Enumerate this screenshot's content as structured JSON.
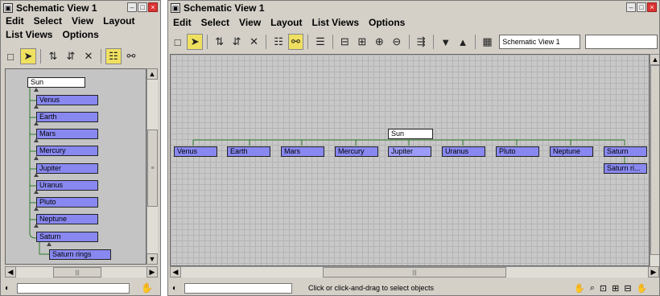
{
  "left_window": {
    "title": "Schematic View 1",
    "menu": [
      "Edit",
      "Select",
      "View",
      "Layout",
      "List Views",
      "Options"
    ],
    "nodes": [
      "Sun",
      "Venus",
      "Earth",
      "Mars",
      "Mercury",
      "Jupiter",
      "Uranus",
      "Pluto",
      "Neptune",
      "Saturn",
      "Saturn rings"
    ]
  },
  "right_window": {
    "title": "Schematic View 1",
    "menu": [
      "Edit",
      "Select",
      "View",
      "Layout",
      "List Views",
      "Options"
    ],
    "view_name_field": "Schematic View 1",
    "nodes": [
      "Sun",
      "Venus",
      "Earth",
      "Mars",
      "Mercury",
      "Jupiter",
      "Uranus",
      "Pluto",
      "Neptune",
      "Saturn",
      "Saturn ri..."
    ],
    "status_message": "Click or click-and-drag to select objects"
  },
  "icons": {
    "title": "schematic-view-icon",
    "minimize": "minimize-icon",
    "maximize": "maximize-icon",
    "close": "close-icon",
    "select": "select-arrow-icon",
    "hand": "pan-hand-icon"
  }
}
